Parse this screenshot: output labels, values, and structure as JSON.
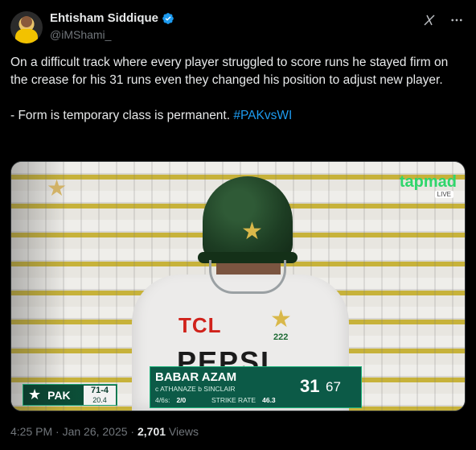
{
  "author": {
    "display_name": "Ehtisham Siddique",
    "handle": "@iMShami_"
  },
  "tweet": {
    "text": "On a difficult track where every player struggled to score runs he stayed firm on the crease for his 31 runs even they changed his position to adjust new player.\n\n- Form is temporary class is permanent. ",
    "hashtag": "#PAKvsWI"
  },
  "media": {
    "broadcaster": "tapmad",
    "broadcaster_sub": "LIVE",
    "jersey_sponsor_1": "TCL",
    "jersey_sponsor_2": "PEPSI",
    "badge_number": "222",
    "scorebug": {
      "team": "PAK",
      "team_score": "71-4",
      "overs": "20.4",
      "batter": "BABAR AZAM",
      "dismissal": "c ATHANAZE  b SINCLAIR",
      "boundaries_label": "4/6s:",
      "boundaries_value": "2/0",
      "strike_rate_label": "STRIKE RATE",
      "strike_rate_value": "46.3",
      "runs": "31",
      "balls": "67"
    }
  },
  "footer": {
    "time_date": "4:25 PM · Jan 26, 2025 · ",
    "views_count": "2,701",
    "views_label": " Views"
  },
  "icons": [
    "verified-badge-icon",
    "grok-icon",
    "more-options-icon",
    "pakistan-star-icon"
  ],
  "colors": {
    "background": "#000000",
    "text": "#e7e9ea",
    "secondary": "#71767b",
    "link": "#1d9bf0",
    "verified": "#1d9bf0"
  }
}
